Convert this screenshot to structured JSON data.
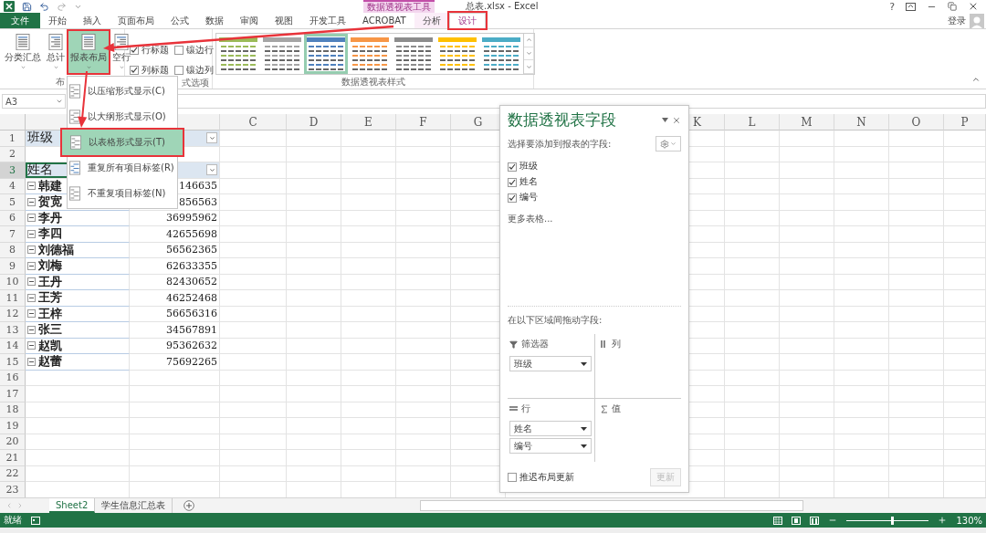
{
  "window": {
    "title": "总表.xlsx - Excel",
    "context_group": "数据透视表工具",
    "help": "?"
  },
  "ribbon_tabs": [
    {
      "label": "文件",
      "kind": "file",
      "selected": false,
      "highlighted": false
    },
    {
      "label": "开始",
      "kind": "normal",
      "selected": false,
      "highlighted": false
    },
    {
      "label": "插入",
      "kind": "normal",
      "selected": false,
      "highlighted": false
    },
    {
      "label": "页面布局",
      "kind": "normal",
      "selected": false,
      "highlighted": false
    },
    {
      "label": "公式",
      "kind": "normal",
      "selected": false,
      "highlighted": false
    },
    {
      "label": "数据",
      "kind": "normal",
      "selected": false,
      "highlighted": false
    },
    {
      "label": "审阅",
      "kind": "normal",
      "selected": false,
      "highlighted": false
    },
    {
      "label": "视图",
      "kind": "normal",
      "selected": false,
      "highlighted": false
    },
    {
      "label": "开发工具",
      "kind": "normal",
      "selected": false,
      "highlighted": false
    },
    {
      "label": "ACROBAT",
      "kind": "normal",
      "selected": false,
      "highlighted": false
    },
    {
      "label": "分析",
      "kind": "context",
      "selected": false,
      "highlighted": false
    },
    {
      "label": "设计",
      "kind": "context",
      "selected": true,
      "highlighted": true
    }
  ],
  "account": {
    "label": "登录"
  },
  "ribbon": {
    "layout_buttons": [
      {
        "label": "分类汇总",
        "pressed": false,
        "highlighted": false
      },
      {
        "label": "总计",
        "pressed": false,
        "highlighted": false
      },
      {
        "label": "报表布局",
        "pressed": true,
        "highlighted": true
      },
      {
        "label": "空行",
        "pressed": false,
        "highlighted": false
      }
    ],
    "layout_group_label": "布",
    "style_options": [
      {
        "label": "行标题",
        "checked": true
      },
      {
        "label": "镶边行",
        "checked": false
      },
      {
        "label": "列标题",
        "checked": true
      },
      {
        "label": "镶边列",
        "checked": false
      }
    ],
    "style_options_label": "式选项",
    "styles": [
      {
        "color": "#9bbb59",
        "selected": false
      },
      {
        "color": "#a5a5a5",
        "selected": false
      },
      {
        "color": "#4f81bd",
        "selected": true
      },
      {
        "color": "#f79646",
        "selected": false
      },
      {
        "color": "#8c8c8c",
        "selected": false
      },
      {
        "color": "#ffc000",
        "selected": false
      },
      {
        "color": "#4bacc6",
        "selected": false
      }
    ],
    "styles_label": "数据透视表样式"
  },
  "layout_menu": {
    "items": [
      {
        "label": "以压缩形式显示(C)",
        "selected": false
      },
      {
        "label": "以大纲形式显示(O)",
        "selected": false
      },
      {
        "label": "以表格形式显示(T)",
        "selected": true
      },
      {
        "label": "重复所有项目标签(R)",
        "selected": false
      },
      {
        "label": "不重复项目标签(N)",
        "selected": false
      }
    ]
  },
  "formula_bar": {
    "name_box": "A3"
  },
  "sheet": {
    "columns": [
      {},
      {},
      {
        "label": "C"
      },
      {
        "label": "D"
      },
      {
        "label": "E"
      },
      {
        "label": "F"
      },
      {
        "label": "G"
      },
      {
        "label": "K"
      },
      {
        "label": "L"
      },
      {
        "label": "M"
      },
      {
        "label": "N"
      },
      {
        "label": "O"
      },
      {
        "label": "P"
      }
    ],
    "rows": [
      {
        "number": "1",
        "kind": "filter",
        "label": "班级",
        "selected": false
      },
      {
        "number": "2",
        "kind": "blank",
        "selected": false
      },
      {
        "number": "3",
        "kind": "header",
        "label": "姓名",
        "selected": true
      },
      {
        "number": "4",
        "kind": "item",
        "label": "韩建",
        "value": "146635",
        "selected": false
      },
      {
        "number": "5",
        "kind": "item",
        "label": "贺宽",
        "value": "856563",
        "selected": false
      },
      {
        "number": "6",
        "kind": "item",
        "label": "李丹",
        "value": "36995962",
        "selected": false
      },
      {
        "number": "7",
        "kind": "item",
        "label": "李四",
        "value": "42655698",
        "selected": false
      },
      {
        "number": "8",
        "kind": "item",
        "label": "刘德福",
        "value": "56562365",
        "selected": false
      },
      {
        "number": "9",
        "kind": "item",
        "label": "刘梅",
        "value": "62633355",
        "selected": false
      },
      {
        "number": "10",
        "kind": "item",
        "label": "王丹",
        "value": "82430652",
        "selected": false
      },
      {
        "number": "11",
        "kind": "item",
        "label": "王芳",
        "value": "46252468",
        "selected": false
      },
      {
        "number": "12",
        "kind": "item",
        "label": "王梓",
        "value": "56656316",
        "selected": false
      },
      {
        "number": "13",
        "kind": "item",
        "label": "张三",
        "value": "34567891",
        "selected": false
      },
      {
        "number": "14",
        "kind": "item",
        "label": "赵凯",
        "value": "95362632",
        "selected": false
      },
      {
        "number": "15",
        "kind": "item",
        "label": "赵蕾",
        "value": "75692265",
        "selected": false
      },
      {
        "number": "16",
        "kind": "blank",
        "selected": false
      },
      {
        "number": "17",
        "kind": "blank",
        "selected": false
      },
      {
        "number": "18",
        "kind": "blank",
        "selected": false
      },
      {
        "number": "19",
        "kind": "blank",
        "selected": false
      },
      {
        "number": "20",
        "kind": "blank",
        "selected": false
      },
      {
        "number": "21",
        "kind": "blank",
        "selected": false
      },
      {
        "number": "22",
        "kind": "blank",
        "selected": false
      },
      {
        "number": "23",
        "kind": "blank",
        "selected": false
      }
    ]
  },
  "pivot_pane": {
    "title": "数据透视表字段",
    "prompt": "选择要添加到报表的字段:",
    "fields": [
      {
        "label": "班级",
        "checked": true
      },
      {
        "label": "姓名",
        "checked": true
      },
      {
        "label": "编号",
        "checked": true
      }
    ],
    "more_tables": "更多表格...",
    "areas_prompt": "在以下区域间拖动字段:",
    "areas": [
      {
        "kind": "filters",
        "label": "筛选器",
        "fields": [
          "班级"
        ]
      },
      {
        "kind": "columns",
        "label": "列"
      },
      {
        "kind": "rows",
        "label": "行",
        "fields": [
          "姓名",
          "编号"
        ]
      },
      {
        "kind": "values",
        "label": "值"
      }
    ],
    "defer": {
      "label": "推迟布局更新",
      "checked": false
    },
    "update_button": {
      "label": "更新",
      "disabled": true
    }
  },
  "sheet_tabs": [
    {
      "label": "Sheet2",
      "selected": true
    },
    {
      "label": "学生信息汇总表",
      "selected": false
    }
  ],
  "status_bar": {
    "ready": "就绪",
    "zoom": {
      "level": 0.55,
      "reading": "130%"
    }
  }
}
